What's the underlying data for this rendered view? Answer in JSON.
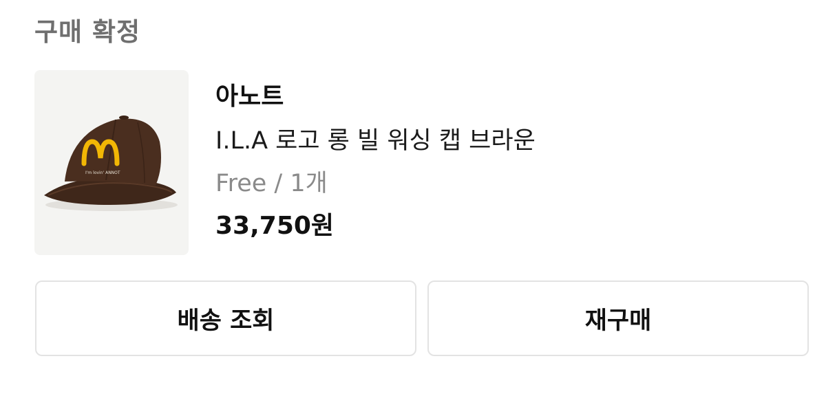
{
  "order": {
    "status_title": "구매 확정"
  },
  "product": {
    "brand": "아노트",
    "name": "I.L.A 로고 롱 빌 워싱 캡 브라운",
    "option": "Free / 1개",
    "price": "33,750원",
    "image_icon": "brown-cap-product-image",
    "cap_text": "I'm lovin' ANNOT",
    "colors": {
      "cap_brown": "#4a2e1f",
      "logo_yellow": "#f2b705"
    }
  },
  "actions": {
    "track_delivery_label": "배송 조회",
    "repurchase_label": "재구매"
  }
}
